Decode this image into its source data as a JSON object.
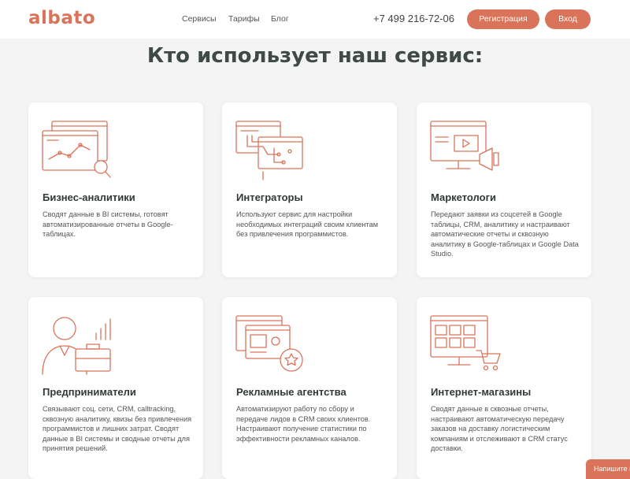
{
  "header": {
    "logo": "albato",
    "nav": [
      "Сервисы",
      "Тарифы",
      "Блог"
    ],
    "phone": "+7 499 216-72-06",
    "register_label": "Регистрация",
    "login_label": "Вход"
  },
  "section_title": "Кто использует наш сервис:",
  "cards": [
    {
      "title": "Бизнес-аналитики",
      "text": "Сводят данные в BI системы, готовят автоматизированные отчеты в Google-таблицах.",
      "icon": "analytics-icon"
    },
    {
      "title": "Интеграторы",
      "text": "Используют сервис для настройки необходимых интеграций своим клиентам без привлечения программистов.",
      "icon": "integration-icon"
    },
    {
      "title": "Маркетологи",
      "text": "Передают заявки из соцсетей в Google таблицы, CRM, аналитику и настраивают автоматические отчеты и сквозную аналитику в Google-таблицах и Google Data Studio.",
      "icon": "marketing-icon"
    },
    {
      "title": "Предприниматели",
      "text": "Связывают соц. сети, CRM, calltracking, сквозную аналитику, квизы без привлечения программистов и лишних затрат. Сводят данные в BI системы и сводные отчеты для принятия решений.",
      "icon": "entrepreneur-icon"
    },
    {
      "title": "Рекламные агентства",
      "text": "Автоматизируют работу по сбору и передаче лидов в CRM своих клиентов. Настраивают получение статистики по эффективности рекламных каналов.",
      "icon": "agency-icon"
    },
    {
      "title": "Интернет-магазины",
      "text": "Сводят данные в сквозные отчеты, настраивают автоматическую передачу заказов на доставку логистическим компаниям и отслеживают в CRM статус доставки.",
      "icon": "ecommerce-icon"
    }
  ],
  "chat_label": "Напишите нам",
  "colors": {
    "accent": "#d9735a",
    "background": "#f4f4f4"
  }
}
